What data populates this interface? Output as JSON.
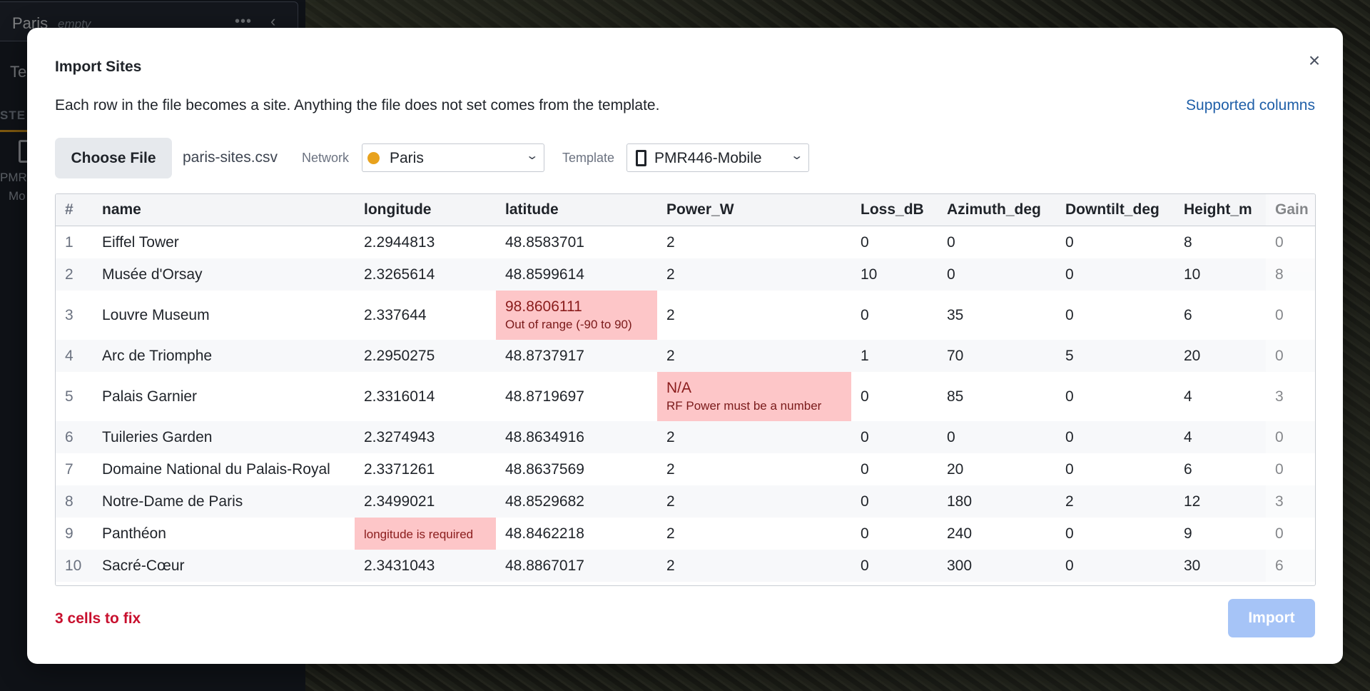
{
  "sidebar": {
    "title": "Paris",
    "subtitle": "empty",
    "tab_partial": "Te",
    "section_partial": "STE",
    "template_label_line1": "PMR",
    "template_label_line2": "Mo"
  },
  "dialog": {
    "title": "Import Sites",
    "description": "Each row in the file becomes a site. Anything the file does not set comes from the template.",
    "supported_link": "Supported columns",
    "choose_file_label": "Choose File",
    "filename": "paris-sites.csv",
    "network_label": "Network",
    "network_value": "Paris",
    "template_label": "Template",
    "template_value": "PMR446-Mobile",
    "cells_to_fix": "3 cells to fix",
    "import_label": "Import"
  },
  "table": {
    "headers": [
      "#",
      "name",
      "longitude",
      "latitude",
      "Power_W",
      "Loss_dB",
      "Azimuth_deg",
      "Downtilt_deg",
      "Height_m",
      "Gain"
    ],
    "rows": [
      [
        "1",
        "Eiffel Tower",
        "2.2944813",
        "48.8583701",
        "2",
        "0",
        "0",
        "0",
        "8",
        "0"
      ],
      [
        "2",
        "Musée d'Orsay",
        "2.3265614",
        "48.8599614",
        "2",
        "10",
        "0",
        "0",
        "10",
        "8"
      ],
      [
        "3",
        "Louvre Museum",
        "2.337644",
        "98.8606111",
        "2",
        "0",
        "35",
        "0",
        "6",
        "0"
      ],
      [
        "4",
        "Arc de Triomphe",
        "2.2950275",
        "48.8737917",
        "2",
        "1",
        "70",
        "5",
        "20",
        "0"
      ],
      [
        "5",
        "Palais Garnier",
        "2.3316014",
        "48.8719697",
        "N/A",
        "0",
        "85",
        "0",
        "4",
        "3"
      ],
      [
        "6",
        "Tuileries Garden",
        "2.3274943",
        "48.8634916",
        "2",
        "0",
        "0",
        "0",
        "4",
        "0"
      ],
      [
        "7",
        "Domaine National du Palais-Royal",
        "2.3371261",
        "48.8637569",
        "2",
        "0",
        "20",
        "0",
        "6",
        "0"
      ],
      [
        "8",
        "Notre-Dame de Paris",
        "2.3499021",
        "48.8529682",
        "2",
        "0",
        "180",
        "2",
        "12",
        "3"
      ],
      [
        "9",
        "Panthéon",
        "",
        "48.8462218",
        "2",
        "0",
        "240",
        "0",
        "9",
        "0"
      ],
      [
        "10",
        "Sacré-Cœur",
        "2.3431043",
        "48.8867017",
        "2",
        "0",
        "300",
        "0",
        "30",
        "6"
      ]
    ],
    "errors": {
      "row3_latitude": "Out of range (-90 to 90)",
      "row5_power": "RF Power must be a number",
      "row9_longitude": "longitude is required"
    }
  },
  "colors": {
    "accent_orange": "#e8a21d",
    "error_bg": "#fdc6c8",
    "error_text": "#c8102e",
    "link": "#1f5fa8",
    "import_disabled": "#a6c4f7"
  }
}
